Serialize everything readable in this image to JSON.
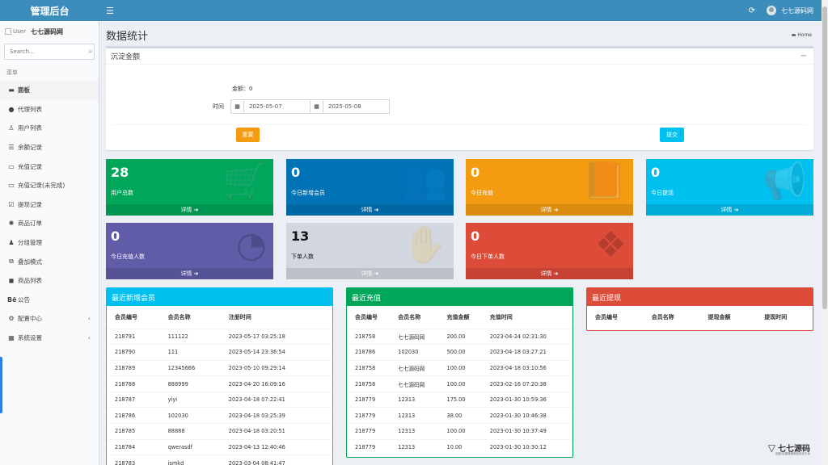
{
  "header": {
    "brand": "管理后台",
    "menu_icon": "hamburger-icon",
    "refresh_icon": "refresh-icon",
    "username": "七七源码网"
  },
  "sidebar": {
    "user_img_alt": "User",
    "user_name": "七七源码网",
    "search_placeholder": "Search...",
    "menu_header": "菜单",
    "items": [
      {
        "label": "面板",
        "icon": "dashboard-icon",
        "active": true
      },
      {
        "label": "代理列表",
        "icon": "circle-icon"
      },
      {
        "label": "用户列表",
        "icon": "user-icon"
      },
      {
        "label": "余额记录",
        "icon": "list-icon"
      },
      {
        "label": "充值记录",
        "icon": "card-icon"
      },
      {
        "label": "充值记录(未完成)",
        "icon": "card-outline-icon"
      },
      {
        "label": "提现记录",
        "icon": "checkbox-icon"
      },
      {
        "label": "商品订单",
        "icon": "gear-icon"
      },
      {
        "label": "分组管理",
        "icon": "users-icon"
      },
      {
        "label": "叠加模式",
        "icon": "layers-icon"
      },
      {
        "label": "商品列表",
        "icon": "cube-icon"
      },
      {
        "label": "公告",
        "icon": "behance-icon"
      },
      {
        "label": "配置中心",
        "icon": "cog-icon",
        "caret": true
      },
      {
        "label": "系统设置",
        "icon": "table-icon",
        "caret": true
      }
    ]
  },
  "page": {
    "title": "数据统计",
    "breadcrumb": "Home"
  },
  "filter": {
    "box_title": "沉淀金额",
    "amount_label": "金额：",
    "amount_value": "0",
    "time_label": "时间",
    "date_start": "2025-05-07",
    "date_end": "2025-05-08",
    "reset_label": "重置",
    "submit_label": "提交"
  },
  "stats": [
    {
      "value": "28",
      "label": "用户总数",
      "more": "详情",
      "color": "#00a65a",
      "icon": "cart-icon"
    },
    {
      "value": "0",
      "label": "今日新增会员",
      "more": "详情",
      "color": "#0073b7",
      "icon": "users-icon"
    },
    {
      "value": "0",
      "label": "今日充值",
      "more": "详情",
      "color": "#f39c12",
      "icon": "book-icon"
    },
    {
      "value": "0",
      "label": "今日提现",
      "more": "详情",
      "color": "#00c0ef",
      "icon": "bullhorn-icon"
    },
    {
      "value": "0",
      "label": "今日充值人数",
      "more": "详情",
      "color": "#605ca8",
      "icon": "pacman-icon"
    },
    {
      "value": "13",
      "label": "下单人数",
      "more": "详情",
      "color": "#d2d6de",
      "icon": "sign-language-icon"
    },
    {
      "value": "0",
      "label": "今日下单人数",
      "more": "详情",
      "color": "#dd4b39",
      "icon": "dropbox-icon"
    }
  ],
  "new_members": {
    "title": "最近新增会员",
    "color": "#00c0ef",
    "columns": [
      "会员编号",
      "会员名称",
      "注册时间"
    ],
    "rows": [
      [
        "218791",
        "111122",
        "2023-05-17 03:25:18"
      ],
      [
        "218790",
        "111",
        "2023-05-14 23:36:54"
      ],
      [
        "218789",
        "12345666",
        "2023-05-10 09:29:14"
      ],
      [
        "218788",
        "888999",
        "2023-04-20 16:09:16"
      ],
      [
        "218787",
        "yiyi",
        "2023-04-18 07:22:41"
      ],
      [
        "218786",
        "102030",
        "2023-04-18 03:25:39"
      ],
      [
        "218785",
        "88888",
        "2023-04-18 03:20:51"
      ],
      [
        "218784",
        "qwerasdf",
        "2023-04-13 12:40:46"
      ],
      [
        "218783",
        "jsmkd",
        "2023-03-04 08:41:47"
      ]
    ]
  },
  "recharges": {
    "title": "最近充值",
    "color": "#00a65a",
    "columns": [
      "会员编号",
      "会员名称",
      "充值金额",
      "充值时间"
    ],
    "rows": [
      [
        "218758",
        "七七源码网",
        "200.00",
        "2023-04-24 02:31:30"
      ],
      [
        "218786",
        "102030",
        "500.00",
        "2023-04-18 03:27:21"
      ],
      [
        "218758",
        "七七源码网",
        "100.00",
        "2023-04-18 03:10:56"
      ],
      [
        "218758",
        "七七源码网",
        "100.00",
        "2023-02-16 07:20:38"
      ],
      [
        "218779",
        "12313",
        "175.00",
        "2023-01-30 10:59:36"
      ],
      [
        "218779",
        "12313",
        "38.00",
        "2023-01-30 10:46:38"
      ],
      [
        "218779",
        "12313",
        "100.00",
        "2023-01-30 10:37:49"
      ],
      [
        "218779",
        "12313",
        "10.00",
        "2023-01-30 10:30:12"
      ]
    ]
  },
  "withdrawals": {
    "title": "最近提现",
    "color": "#dd4b39",
    "columns": [
      "会员编号",
      "会员名称",
      "提现金额",
      "提现时间"
    ],
    "rows": []
  },
  "watermark": {
    "text": "七七源码",
    "sub": "百度/百度搜索网站优化平台"
  }
}
